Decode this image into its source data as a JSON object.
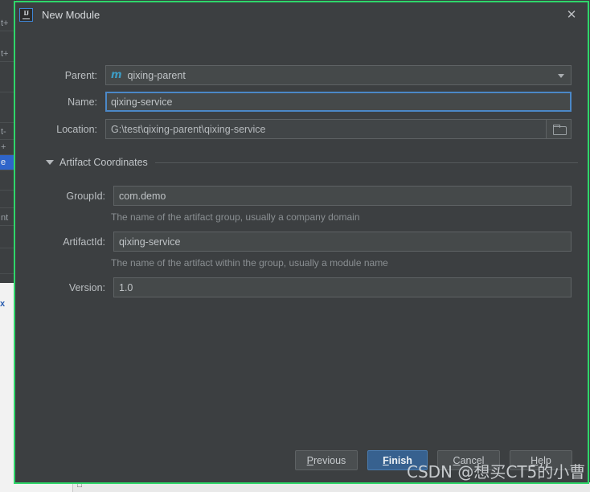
{
  "backdrop": {
    "ide_rows": [
      {
        "text": "t+",
        "selected": false
      },
      {
        "text": "t+",
        "selected": false
      },
      {
        "text": "",
        "selected": false
      },
      {
        "text": "",
        "selected": false
      },
      {
        "text": "t-",
        "selected": false
      },
      {
        "text": "+",
        "selected": false
      },
      {
        "text": "e",
        "selected": true
      },
      {
        "text": "",
        "selected": false
      },
      {
        "text": "",
        "selected": false
      },
      {
        "text": "nt",
        "selected": false
      },
      {
        "text": "",
        "selected": false
      },
      {
        "text": "",
        "selected": false
      }
    ],
    "left_panel_mark": "x",
    "bottom_tab_glyph": "□"
  },
  "dialog": {
    "title": "New Module",
    "app_icon": "intellij-idea-icon",
    "app_icon_text": "IJ",
    "close_icon": "✕",
    "fields": [
      {
        "id": "parent",
        "label": "Parent:",
        "value": "qixing-parent",
        "type": "combobox",
        "prefix_icon": "maven-module-icon",
        "prefix_icon_text": "m"
      },
      {
        "id": "name",
        "label": "Name:",
        "value": "qixing-service",
        "type": "text",
        "focused": true
      },
      {
        "id": "location",
        "label": "Location:",
        "value": "G:\\test\\qixing-parent\\qixing-service",
        "type": "text-with-browse",
        "browse_icon": "folder-icon"
      }
    ],
    "section": {
      "title": "Artifact Coordinates",
      "expanded": true,
      "expander_icon": "chevron-down-icon",
      "fields": [
        {
          "id": "groupid",
          "label": "GroupId:",
          "value": "com.demo",
          "hint": "The name of the artifact group, usually a company domain"
        },
        {
          "id": "artifactid",
          "label": "ArtifactId:",
          "value": "qixing-service",
          "hint": "The name of the artifact within the group, usually a module name"
        },
        {
          "id": "version",
          "label": "Version:",
          "value": "1.0",
          "hint": ""
        }
      ]
    },
    "buttons": [
      {
        "id": "previous",
        "mnemonic": "P",
        "rest": "revious",
        "primary": false
      },
      {
        "id": "finish",
        "mnemonic": "F",
        "rest": "inish",
        "primary": true
      },
      {
        "id": "cancel",
        "mnemonic": "C",
        "rest": "ancel",
        "primary": false
      },
      {
        "id": "help",
        "mnemonic": "H",
        "rest": "elp",
        "primary": false
      }
    ]
  },
  "watermark": {
    "text": "CSDN @想买CT5的小曹"
  },
  "colors": {
    "dialog_bg": "#3c3f41",
    "dialog_border": "#2fd66a",
    "field_bg": "#45494a",
    "field_border": "#5e6264",
    "focus_border": "#4b88c7",
    "primary_button": "#37618f",
    "text": "#bbbfc2",
    "hint_text": "#8a8f92",
    "maven_icon": "#3d9cc4"
  }
}
